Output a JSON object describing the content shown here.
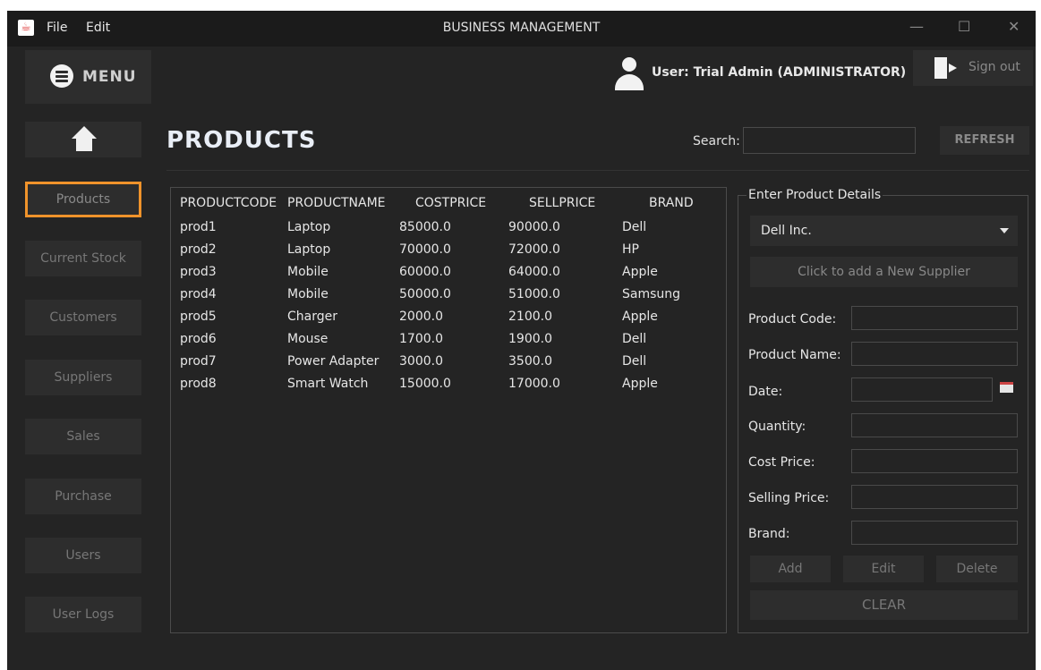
{
  "titlebar": {
    "menu_file": "File",
    "menu_edit": "Edit",
    "title": "BUSINESS MANAGEMENT",
    "minimize": "—",
    "maximize": "☐",
    "close": "✕"
  },
  "header": {
    "menu_label": "MENU",
    "user_label": "User: Trial Admin (ADMINISTRATOR)",
    "signout_label": "Sign out"
  },
  "sidebar": {
    "items": [
      {
        "label": "Products",
        "active": true
      },
      {
        "label": "Current Stock"
      },
      {
        "label": "Customers"
      },
      {
        "label": "Suppliers"
      },
      {
        "label": "Sales"
      },
      {
        "label": "Purchase"
      },
      {
        "label": "Users"
      },
      {
        "label": "User Logs"
      }
    ]
  },
  "main": {
    "title": "PRODUCTS",
    "search_label": "Search:",
    "search_value": "",
    "refresh_label": "REFRESH"
  },
  "table": {
    "headers": [
      "PRODUCTCODE",
      "PRODUCTNAME",
      "COSTPRICE",
      "SELLPRICE",
      "BRAND"
    ],
    "rows": [
      [
        "prod1",
        "Laptop",
        "85000.0",
        "90000.0",
        "Dell"
      ],
      [
        "prod2",
        "Laptop",
        "70000.0",
        "72000.0",
        "HP"
      ],
      [
        "prod3",
        "Mobile",
        "60000.0",
        "64000.0",
        "Apple"
      ],
      [
        "prod4",
        "Mobile",
        "50000.0",
        "51000.0",
        "Samsung"
      ],
      [
        "prod5",
        "Charger",
        "2000.0",
        "2100.0",
        "Apple"
      ],
      [
        "prod6",
        "Mouse",
        "1700.0",
        "1900.0",
        "Dell"
      ],
      [
        "prod7",
        "Power Adapter",
        "3000.0",
        "3500.0",
        "Dell"
      ],
      [
        "prod8",
        "Smart Watch",
        "15000.0",
        "17000.0",
        "Apple"
      ]
    ]
  },
  "details": {
    "legend": "Enter Product Details",
    "supplier_selected": "Dell Inc.",
    "add_supplier_label": "Click to add a New Supplier",
    "labels": {
      "code": "Product Code:",
      "name": "Product Name:",
      "date": "Date:",
      "quantity": "Quantity:",
      "cost": "Cost Price:",
      "sell": "Selling Price:",
      "brand": "Brand:"
    },
    "add_label": "Add",
    "edit_label": "Edit",
    "delete_label": "Delete",
    "clear_label": "CLEAR"
  },
  "colors": {
    "background": "#242424",
    "panel": "#2d2d2d",
    "active_border": "#f0932b",
    "text": "#e6e6e6"
  },
  "icons": [
    "java-icon",
    "menu-icon",
    "user-icon",
    "signout-icon",
    "home-icon",
    "calendar-icon",
    "dropdown-caret-icon"
  ]
}
